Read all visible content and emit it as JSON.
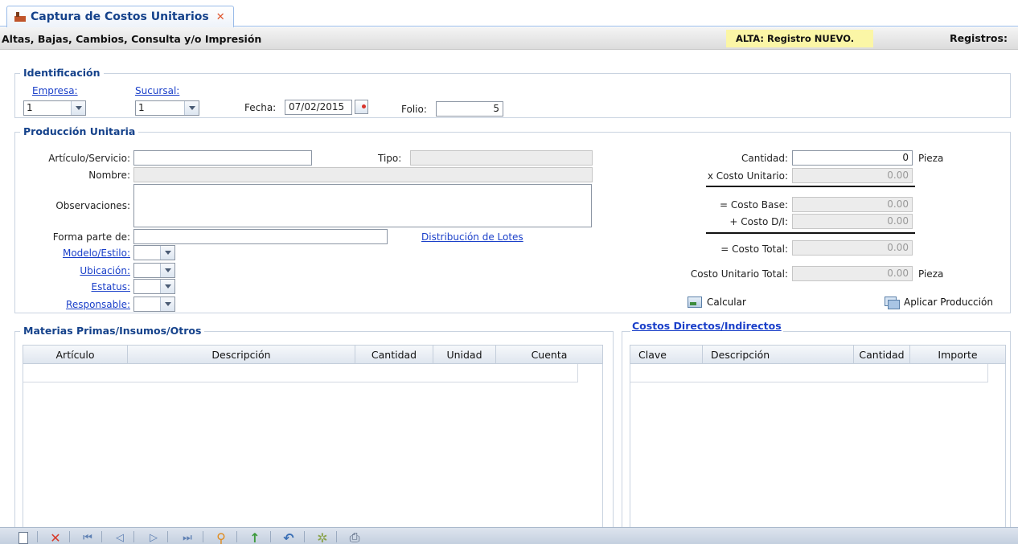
{
  "tab": {
    "title": "Captura de Costos Unitarios",
    "close_glyph": "✕"
  },
  "header": {
    "title": "Altas, Bajas, Cambios, Consulta y/o Impresión",
    "status": "ALTA: Registro NUEVO.",
    "records_label": "Registros: "
  },
  "identificacion": {
    "legend": "Identificación",
    "empresa_label": "Empresa:",
    "empresa_value": "1",
    "sucursal_label": "Sucursal:",
    "sucursal_value": "1",
    "fecha_label": "Fecha:",
    "fecha_value": "07/02/2015",
    "folio_label": "Folio:",
    "folio_value": "5"
  },
  "produccion": {
    "legend": "Producción Unitaria",
    "articulo_label": "Artículo/Servicio:",
    "articulo_value": "",
    "tipo_label": "Tipo:",
    "nombre_label": "Nombre:",
    "observaciones_label": "Observaciones:",
    "forma_parte_label": "Forma parte de:",
    "distribucion_link": "Distribución de Lotes",
    "modelo_label": "Modelo/Estilo:",
    "ubicacion_label": "Ubicación:",
    "estatus_label": "Estatus:",
    "responsable_label": "Responsable:",
    "cantidad_label": "Cantidad:",
    "cantidad_value": "0",
    "cantidad_unit": "Pieza",
    "costo_unitario_label": "x Costo Unitario:",
    "costo_unitario_value": "0.00",
    "costo_base_label": "= Costo Base:",
    "costo_base_value": "0.00",
    "costo_di_label": "+ Costo D/I:",
    "costo_di_value": "0.00",
    "costo_total_label": "= Costo Total:",
    "costo_total_value": "0.00",
    "costo_unitario_total_label": "Costo Unitario Total:",
    "costo_unitario_total_value": "0.00",
    "costo_unitario_total_unit": "Pieza",
    "calcular_label": "Calcular",
    "aplicar_label": "Aplicar Producción"
  },
  "materias": {
    "legend": "Materias Primas/Insumos/Otros",
    "columns": [
      "Artículo",
      "Descripción",
      "Cantidad",
      "Unidad",
      "Cuenta"
    ]
  },
  "costos_di": {
    "legend": "Costos Directos/Indirectos",
    "columns": [
      "Clave",
      "Descripción",
      "Cantidad",
      "Importe"
    ]
  },
  "toolbar": {
    "items": [
      "new-document-icon",
      "delete-icon",
      "first-record-icon",
      "previous-record-icon",
      "next-record-icon",
      "last-record-icon",
      "search-icon",
      "save-icon",
      "undo-icon",
      "process-icon",
      "print-icon"
    ]
  }
}
